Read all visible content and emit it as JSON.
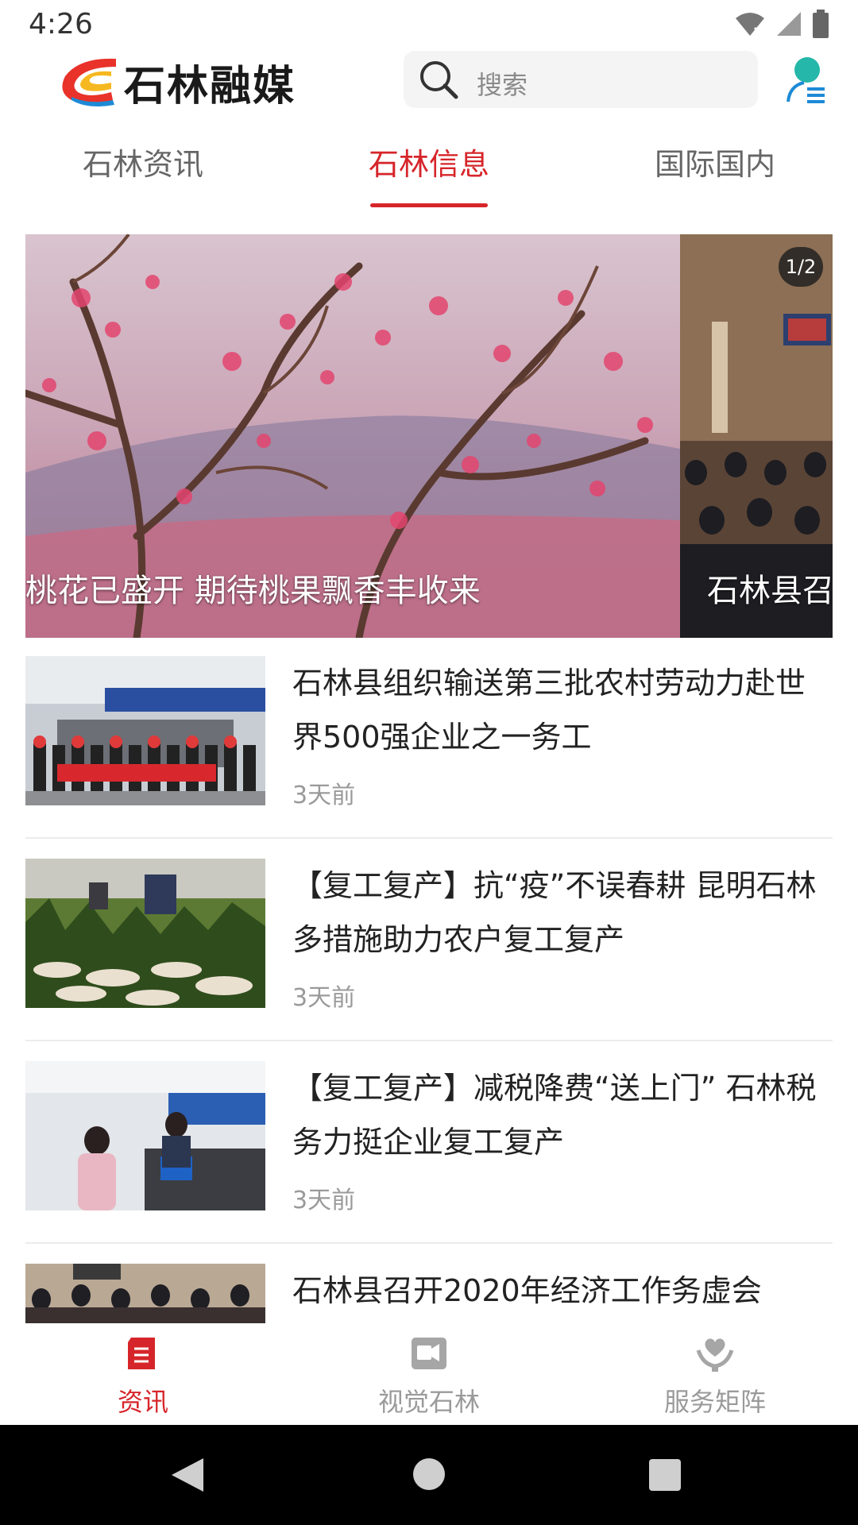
{
  "status_bar": {
    "time": "4:26"
  },
  "header": {
    "logo_text": "石林融媒",
    "search_placeholder": "搜索"
  },
  "tabs": [
    {
      "label": "石林资讯",
      "active": false
    },
    {
      "label": "石林信息",
      "active": true
    },
    {
      "label": "国际国内",
      "active": false
    }
  ],
  "carousel": {
    "indicator": "1/2",
    "slides": [
      {
        "caption": "桃花已盛开 期待桃果飘香丰收来"
      },
      {
        "caption": "石林县召开"
      }
    ]
  },
  "news": [
    {
      "title": "石林县组织输送第三批农村劳动力赴世界500强企业之一务工",
      "time": "3天前"
    },
    {
      "title": "【复工复产】抗“疫”不误春耕 昆明石林多措施助力农户复工复产",
      "time": "3天前"
    },
    {
      "title": "【复工复产】减税降费“送上门” 石林税务力挺企业复工复产",
      "time": "3天前"
    },
    {
      "title": "石林县召开2020年经济工作务虚会",
      "time": ""
    }
  ],
  "bottom_nav": [
    {
      "label": "资讯",
      "icon": "news-icon",
      "active": true
    },
    {
      "label": "视觉石林",
      "icon": "video-icon",
      "active": false
    },
    {
      "label": "服务矩阵",
      "icon": "service-icon",
      "active": false
    }
  ],
  "colors": {
    "accent": "#d6252a",
    "inactive": "#9a9a9a"
  }
}
